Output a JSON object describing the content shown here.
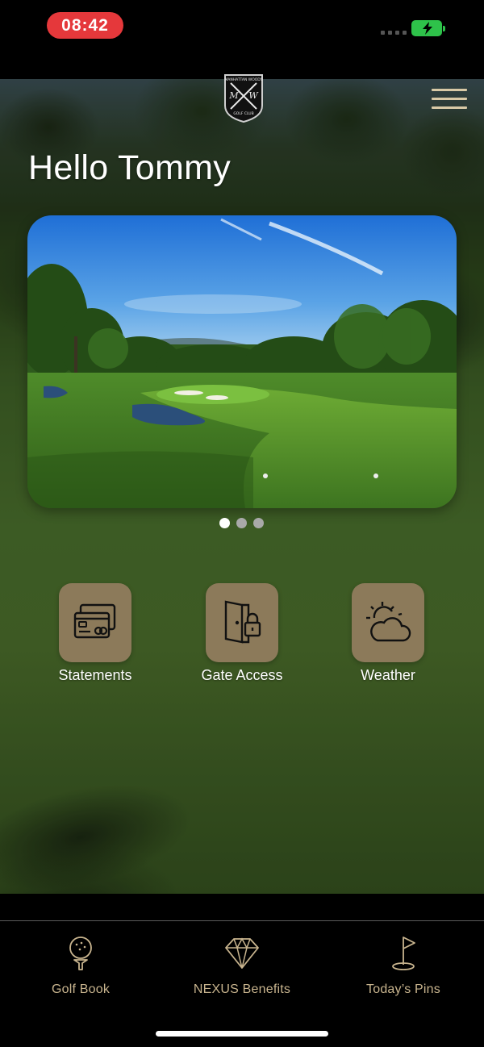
{
  "status_bar": {
    "time": "08:42",
    "battery_state": "charging",
    "battery_color": "#2ec24a",
    "time_pill_color": "#e5383b"
  },
  "header": {
    "logo_icon": "club-crest-logo",
    "logo_text_top": "MANHATTAN WOODS",
    "logo_text_bottom": "GOLF CLUB",
    "menu_icon": "hamburger-menu-icon",
    "greeting": "Hello Tommy"
  },
  "carousel": {
    "image": "golf-course-fairway-photo",
    "dots": [
      {
        "active": true
      },
      {
        "active": false
      },
      {
        "active": false
      }
    ]
  },
  "quick_actions": [
    {
      "label": "Statements",
      "icon": "credit-cards-icon"
    },
    {
      "label": "Gate Access",
      "icon": "door-lock-icon"
    },
    {
      "label": "Weather",
      "icon": "sun-cloud-icon"
    }
  ],
  "tab_bar": {
    "items": [
      {
        "label": "Golf Book",
        "icon": "golf-ball-tee-icon"
      },
      {
        "label": "NEXUS Benefits",
        "icon": "diamond-icon"
      },
      {
        "label": "Today’s Pins",
        "icon": "pin-flag-icon"
      }
    ],
    "accent_color": "#c8b48e"
  },
  "colors": {
    "tile_background": "#8c7a5a",
    "menu_bars": "#d8c9a6"
  }
}
